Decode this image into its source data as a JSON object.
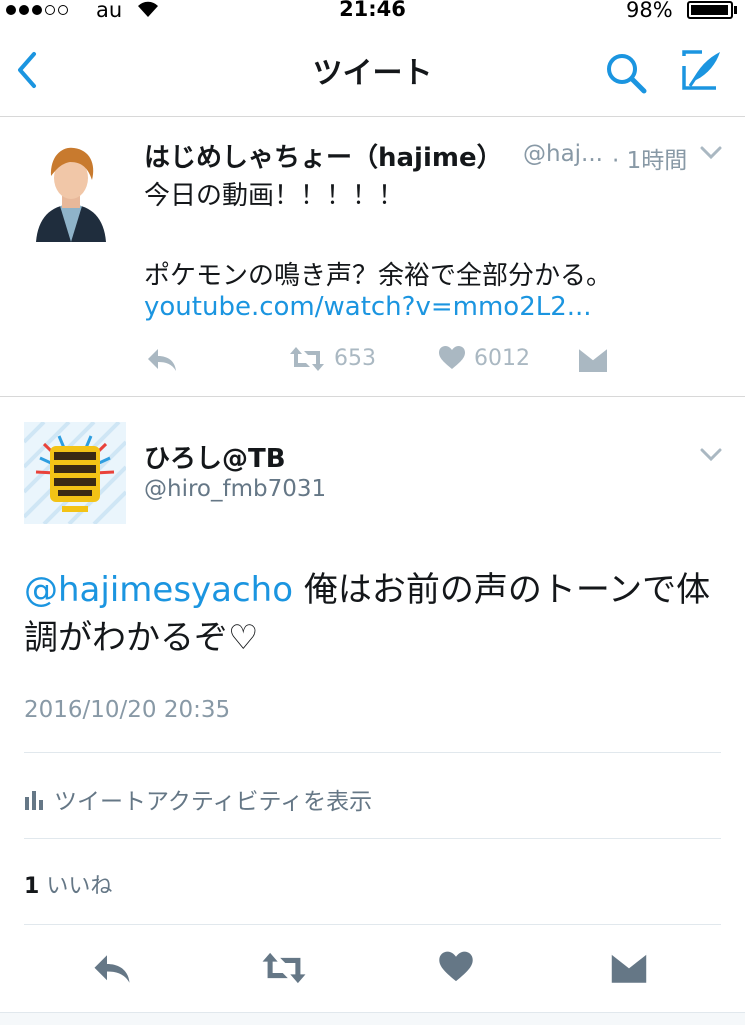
{
  "status_bar": {
    "carrier": "au",
    "time": "21:46",
    "battery": "98%",
    "battery_level": 0.98
  },
  "nav": {
    "title": "ツイート"
  },
  "tweet1": {
    "name": "はじめしゃちょー（hajime）",
    "handle": "@haj...",
    "time": "· 1時間",
    "line1": "今日の動画！！！！！",
    "line2": "ポケモンの鳴き声？余裕で全部分かる。",
    "link": "youtube.com/watch?v=mmo2L2...",
    "retweets": "653",
    "likes": "6012"
  },
  "tweet2": {
    "name": "ひろし@TB",
    "handle": "@hiro_fmb7031",
    "mention": "@hajimesyacho",
    "text": " 俺はお前の声のトーンで体調がわかるぞ♡",
    "date": "2016/10/20 20:35",
    "activity": "ツイートアクティビティを表示",
    "like_count": "1",
    "like_label": "いいね"
  },
  "colors": {
    "accent": "#1b95e0",
    "muted": "#aab8c2",
    "text": "#14171a"
  },
  "icons": [
    "back-chevron-icon",
    "search-icon",
    "compose-icon",
    "chevron-down-icon",
    "reply-icon",
    "retweet-icon",
    "heart-icon",
    "direct-message-icon",
    "bar-chart-icon"
  ]
}
